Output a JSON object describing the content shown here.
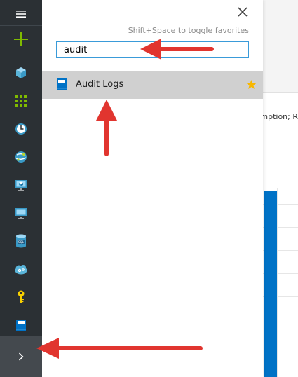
{
  "rail": {
    "items": [
      {
        "id": "menu",
        "icon": "hamburger-menu-icon"
      },
      {
        "id": "new",
        "icon": "plus-icon"
      },
      {
        "id": "resource-groups",
        "icon": "cube-icon"
      },
      {
        "id": "all-resources",
        "icon": "grid-icon"
      },
      {
        "id": "recent",
        "icon": "clock-icon"
      },
      {
        "id": "app-services",
        "icon": "globe-icon"
      },
      {
        "id": "virtual-machines-classic",
        "icon": "monitor-cube-icon"
      },
      {
        "id": "virtual-machines",
        "icon": "monitor-icon"
      },
      {
        "id": "sql-databases",
        "icon": "sql-database-icon"
      },
      {
        "id": "cloud-services",
        "icon": "cloud-gears-icon"
      },
      {
        "id": "key-vault",
        "icon": "key-icon"
      },
      {
        "id": "audit-logs",
        "icon": "book-icon"
      }
    ],
    "expand_icon": "chevron-right-icon"
  },
  "search": {
    "hint": "Shift+Space to toggle favorites",
    "value": "audit",
    "results": [
      {
        "label": "Audit Logs",
        "favorite": true,
        "icon": "book-icon"
      }
    ]
  },
  "background": {
    "subtitle_fragment": "mption; R"
  },
  "colors": {
    "rail_bg": "#2b3034",
    "accent": "#0072c6",
    "plus": "#7fba00",
    "star": "#f8b700",
    "arrow": "#e1352f"
  }
}
